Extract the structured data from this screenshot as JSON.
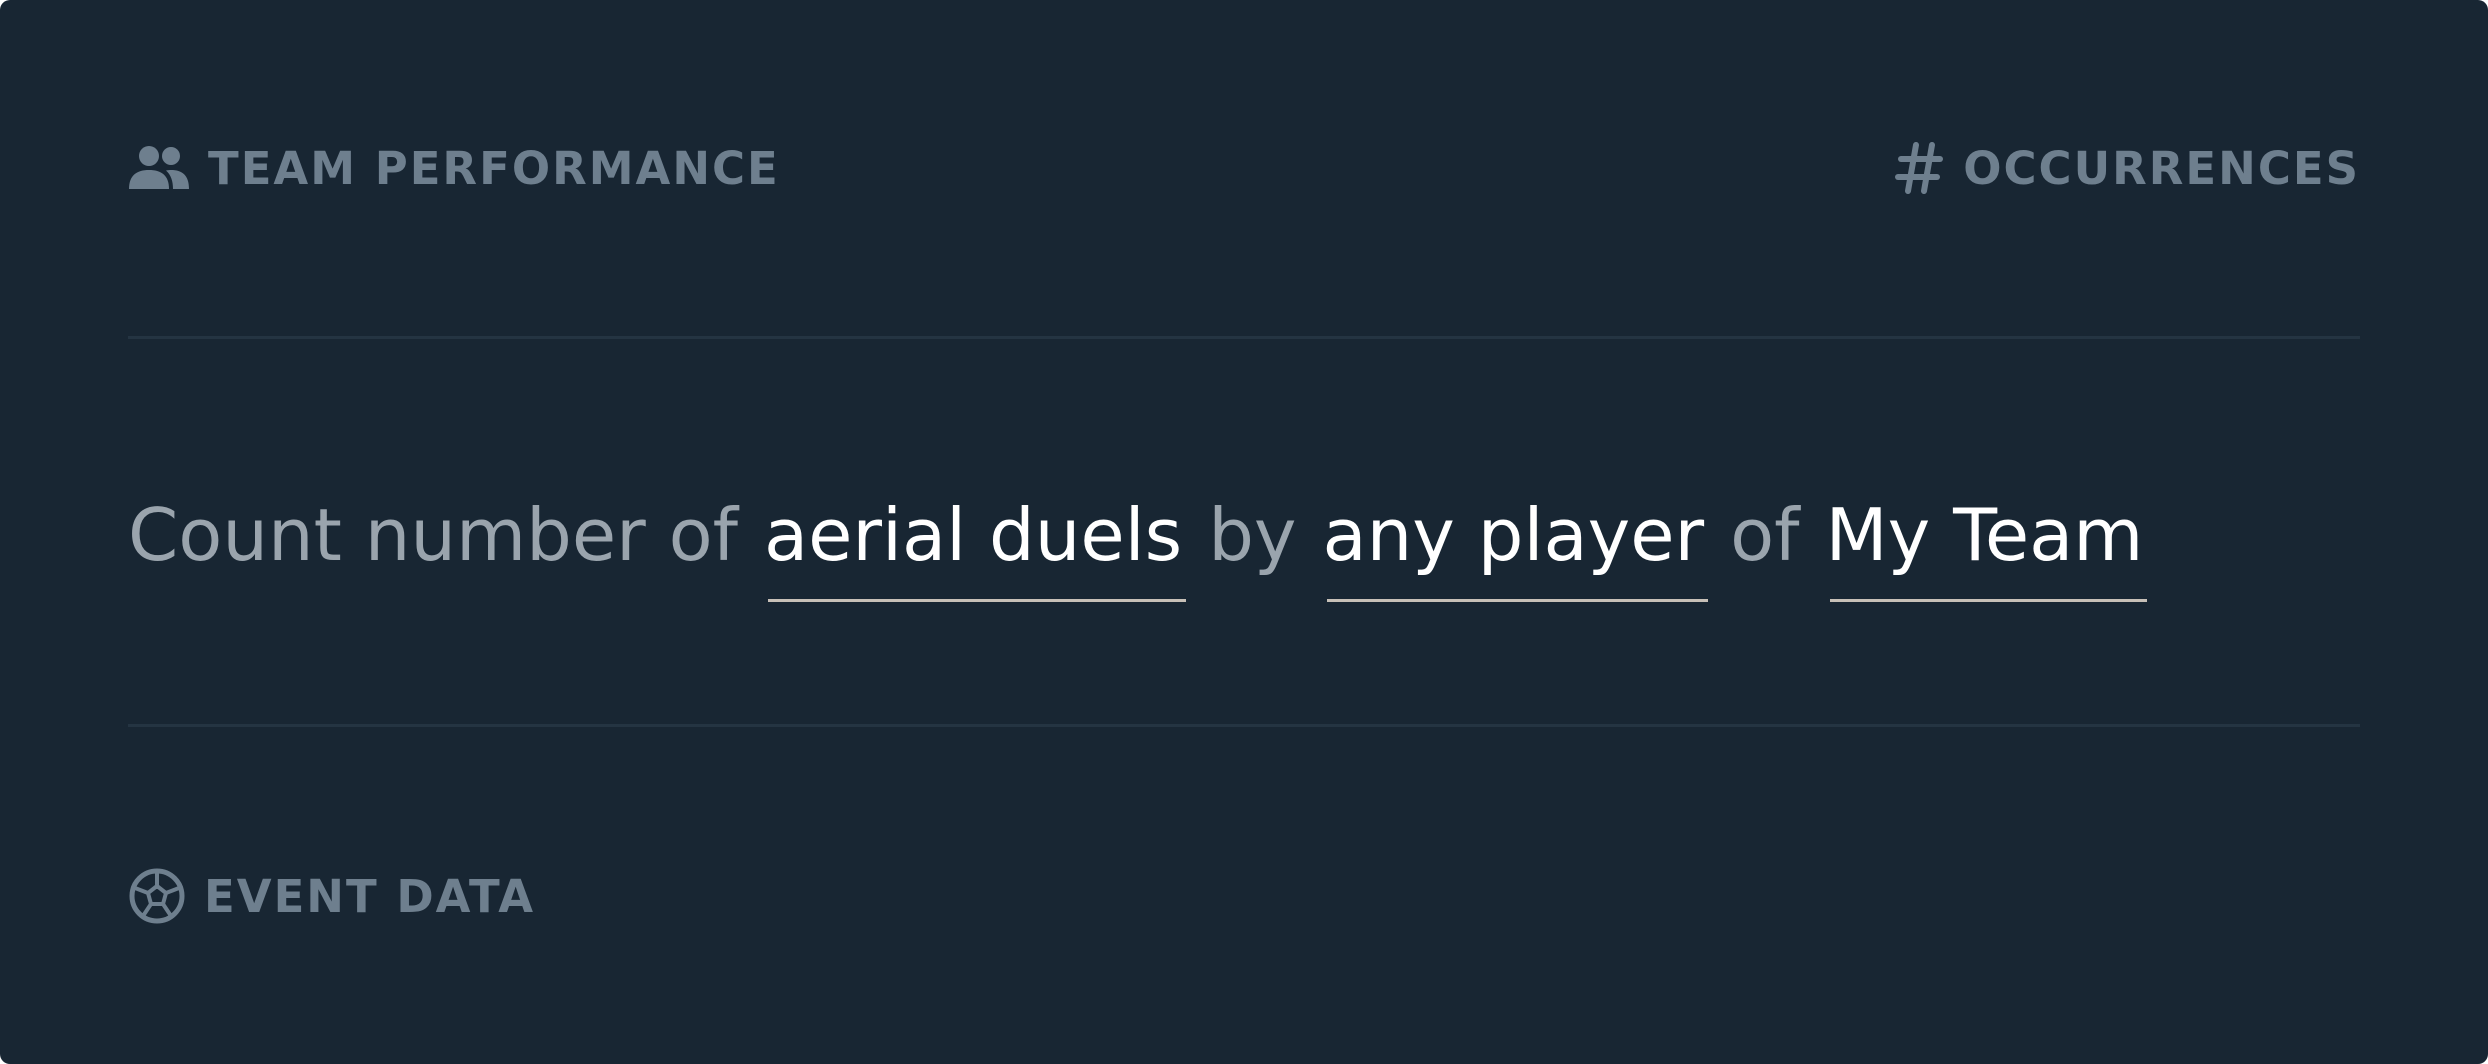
{
  "header": {
    "category_label": "TEAM PERFORMANCE",
    "category_icon": "team-icon",
    "metric_label": "OCCURRENCES",
    "metric_icon": "hash-icon"
  },
  "query": {
    "prefix": "Count number of",
    "event_token": "aerial duels",
    "connector_by": "by",
    "player_token": "any player",
    "connector_of": "of",
    "team_token": "My Team"
  },
  "footer": {
    "source_label": "EVENT DATA",
    "source_icon": "soccer-ball-icon"
  },
  "colors": {
    "background": "#182633",
    "muted_label": "#6e7f8e",
    "muted_text": "#9aa4ad",
    "token_text": "#ffffff",
    "token_underline": "#c7c0b8",
    "divider": "#243442"
  }
}
